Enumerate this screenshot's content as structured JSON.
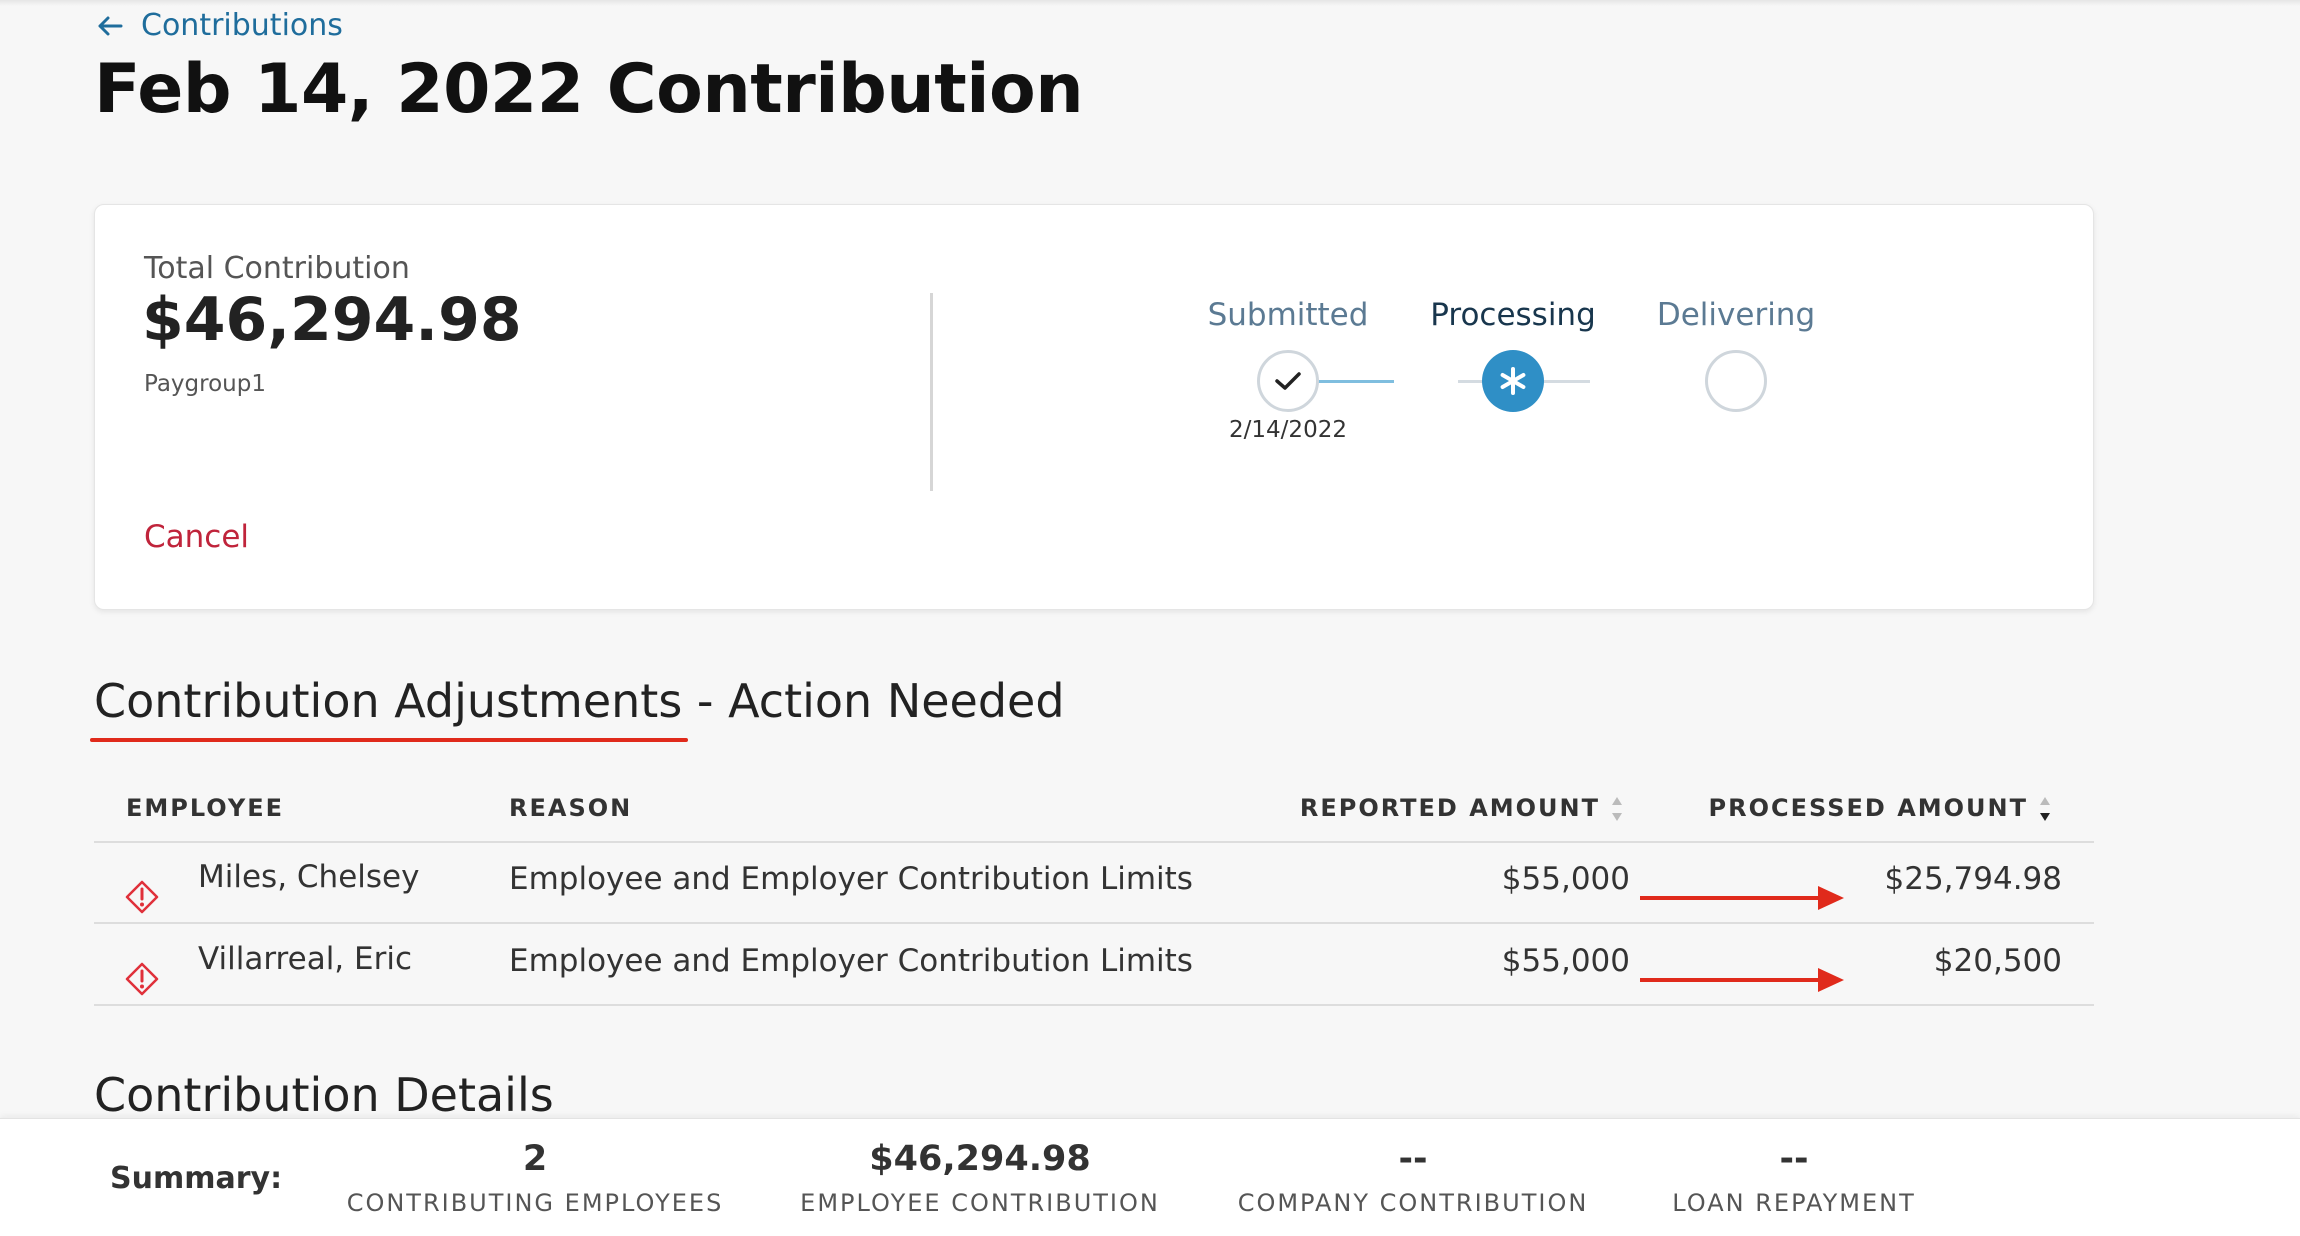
{
  "header": {
    "back_label": "Contributions",
    "title": "Feb 14, 2022 Contribution"
  },
  "card": {
    "total_label": "Total Contribution",
    "total_amount": "$46,294.98",
    "paygroup": "Paygroup1",
    "cancel_label": "Cancel",
    "steps": [
      {
        "label": "Submitted",
        "status": "done",
        "date": "2/14/2022"
      },
      {
        "label": "Processing",
        "status": "current",
        "date": ""
      },
      {
        "label": "Delivering",
        "status": "pending",
        "date": ""
      }
    ]
  },
  "adjustments": {
    "title_main": "Contribution Adjustments",
    "title_suffix": " - Action Needed",
    "columns": {
      "employee": "EMPLOYEE",
      "reason": "REASON",
      "reported": "REPORTED AMOUNT",
      "processed": "PROCESSED AMOUNT"
    },
    "rows": [
      {
        "employee": "Miles, Chelsey",
        "reason": "Employee and Employer Contribution Limits",
        "reported": "$55,000",
        "processed": "$25,794.98"
      },
      {
        "employee": "Villarreal, Eric",
        "reason": "Employee and Employer Contribution Limits",
        "reported": "$55,000",
        "processed": "$20,500"
      }
    ]
  },
  "details": {
    "title": "Contribution Details"
  },
  "summary": {
    "label": "Summary:",
    "items": [
      {
        "value": "2",
        "caption": "CONTRIBUTING EMPLOYEES"
      },
      {
        "value": "$46,294.98",
        "caption": "EMPLOYEE CONTRIBUTION"
      },
      {
        "value": "--",
        "caption": "COMPANY CONTRIBUTION"
      },
      {
        "value": "--",
        "caption": "LOAN REPAYMENT"
      }
    ]
  },
  "colors": {
    "link": "#1f6d9c",
    "cancel": "#c0243b",
    "step_active": "#2f8fc6",
    "annotation_red": "#e02a1b",
    "warning": "#e0303a"
  },
  "icons": {
    "back": "arrow-left-icon",
    "done": "checkmark-icon",
    "current": "asterisk-icon",
    "warning": "warning-diamond-icon",
    "sort": "sort-icon"
  }
}
